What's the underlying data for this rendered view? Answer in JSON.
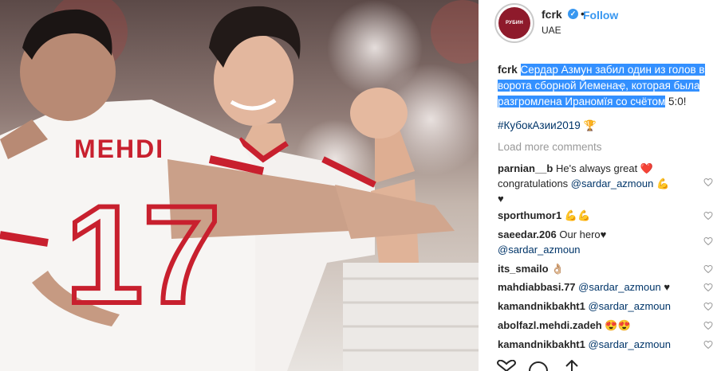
{
  "post": {
    "username": "fcrk",
    "follow_label": "Follow",
    "location": "UAE",
    "avatar_text": "РУБИН",
    "verified_glyph": "✓",
    "dot": "•"
  },
  "photo": {
    "jersey_name": "MEHDI",
    "jersey_number": "17"
  },
  "caption": {
    "username": "fcrk",
    "highlighted_text": "Сердар Азмун забил один из голов в ворота сборной Йеменаҿ, которая была разгромлена Ираномїя со счётом",
    "rest_text": " 5:0!",
    "hashtag": "#КубокАзии2019",
    "hashtag_emoji": "🏆"
  },
  "load_more": "Load more comments",
  "comments": [
    {
      "user": "parnian__b",
      "text": "He's always great",
      "emoji": "❤️",
      "line2_text": "congratulations",
      "mention": "@sardar_azmoun",
      "emoji2": "💪",
      "line3": "♥"
    },
    {
      "user": "sporthumor1",
      "text": "",
      "emoji": "💪💪"
    },
    {
      "user": "saeedar.206",
      "text": "Our hero♥",
      "mention": "@sardar_azmoun"
    },
    {
      "user": "its_smailo",
      "text": "",
      "emoji": "👌🏼"
    },
    {
      "user": "mahdiabbasi.77",
      "mention": "@sardar_azmoun",
      "emoji": "♥"
    },
    {
      "user": "kamandnikbakht1",
      "mention": "@sardar_azmoun"
    },
    {
      "user": "abolfazl.mehdi.zadeh",
      "emoji": "😍😍"
    },
    {
      "user": "kamandnikbakht1",
      "mention": "@sardar_azmoun"
    }
  ],
  "icons": {
    "like": "heart-outline-icon",
    "comment": "comment-icon",
    "share": "share-icon"
  },
  "colors": {
    "accent": "#3897f0",
    "selection": "#3390ff",
    "jersey_red": "#c8202e",
    "hashtag": "#003569"
  }
}
